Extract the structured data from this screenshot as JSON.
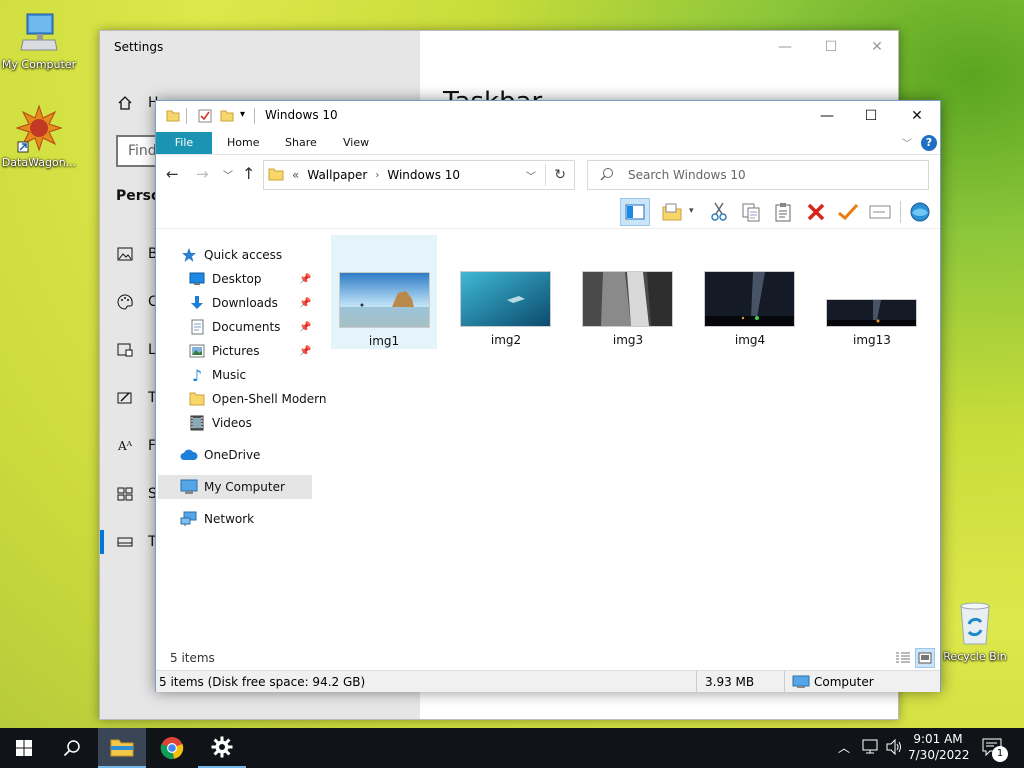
{
  "desktop": {
    "icons": [
      {
        "label": "My Computer",
        "icon": "monitor-icon"
      },
      {
        "label": "DataWagon...",
        "icon": "datawagon-icon"
      },
      {
        "label": "Recycle Bin",
        "icon": "recycle-bin-icon"
      }
    ]
  },
  "settings": {
    "title": "Settings",
    "heading_partial": "Taskbar",
    "home_partial": "H",
    "search_placeholder": "Find",
    "section_partial": "Person",
    "nav": [
      {
        "letter": "B",
        "icon": "image-icon"
      },
      {
        "letter": "C",
        "icon": "palette-icon"
      },
      {
        "letter": "Lo",
        "icon": "lock-screen-icon"
      },
      {
        "letter": "T",
        "icon": "themes-icon"
      },
      {
        "letter": "Fo",
        "icon": "font-icon"
      },
      {
        "letter": "St",
        "icon": "start-icon"
      },
      {
        "letter": "Ta",
        "icon": "taskbar-icon"
      }
    ],
    "controls": {
      "minimize": "—",
      "maximize": "☐",
      "close": "✕"
    }
  },
  "explorer": {
    "title": "Windows 10",
    "controls": {
      "minimize": "—",
      "maximize": "☐",
      "close": "✕"
    },
    "ribbon_tabs": [
      "File",
      "Home",
      "Share",
      "View"
    ],
    "help": "?",
    "address": {
      "overflow": "«",
      "crumbs": [
        "Wallpaper",
        "Windows 10"
      ]
    },
    "search_placeholder": "Search Windows 10",
    "nav_pane": {
      "quick_access": "Quick access",
      "quick_items": [
        {
          "label": "Desktop",
          "icon": "desktop-folder-icon",
          "pinned": true
        },
        {
          "label": "Downloads",
          "icon": "downloads-icon",
          "pinned": true
        },
        {
          "label": "Documents",
          "icon": "documents-icon",
          "pinned": true
        },
        {
          "label": "Pictures",
          "icon": "pictures-icon",
          "pinned": true
        },
        {
          "label": "Music",
          "icon": "music-icon",
          "pinned": false
        },
        {
          "label": "Open-Shell Modern",
          "icon": "folder-icon",
          "pinned": false
        },
        {
          "label": "Videos",
          "icon": "videos-icon",
          "pinned": false
        }
      ],
      "onedrive": "OneDrive",
      "my_computer": "My Computer",
      "network": "Network"
    },
    "files": [
      {
        "name": "img1",
        "thumb_icon": "beach-rock-thumbnail"
      },
      {
        "name": "img2",
        "thumb_icon": "underwater-thumbnail"
      },
      {
        "name": "img3",
        "thumb_icon": "rock-cliff-thumbnail"
      },
      {
        "name": "img4",
        "thumb_icon": "night-sky-thumbnail"
      },
      {
        "name": "img13",
        "thumb_icon": "night-sky-wide-thumbnail"
      }
    ],
    "item_count": "5 items",
    "status": {
      "left": "5 items (Disk free space: 94.2 GB)",
      "size": "3.93 MB",
      "location": "Computer"
    }
  },
  "taskbar": {
    "time": "9:01 AM",
    "date": "7/30/2022",
    "notification_count": "1"
  }
}
